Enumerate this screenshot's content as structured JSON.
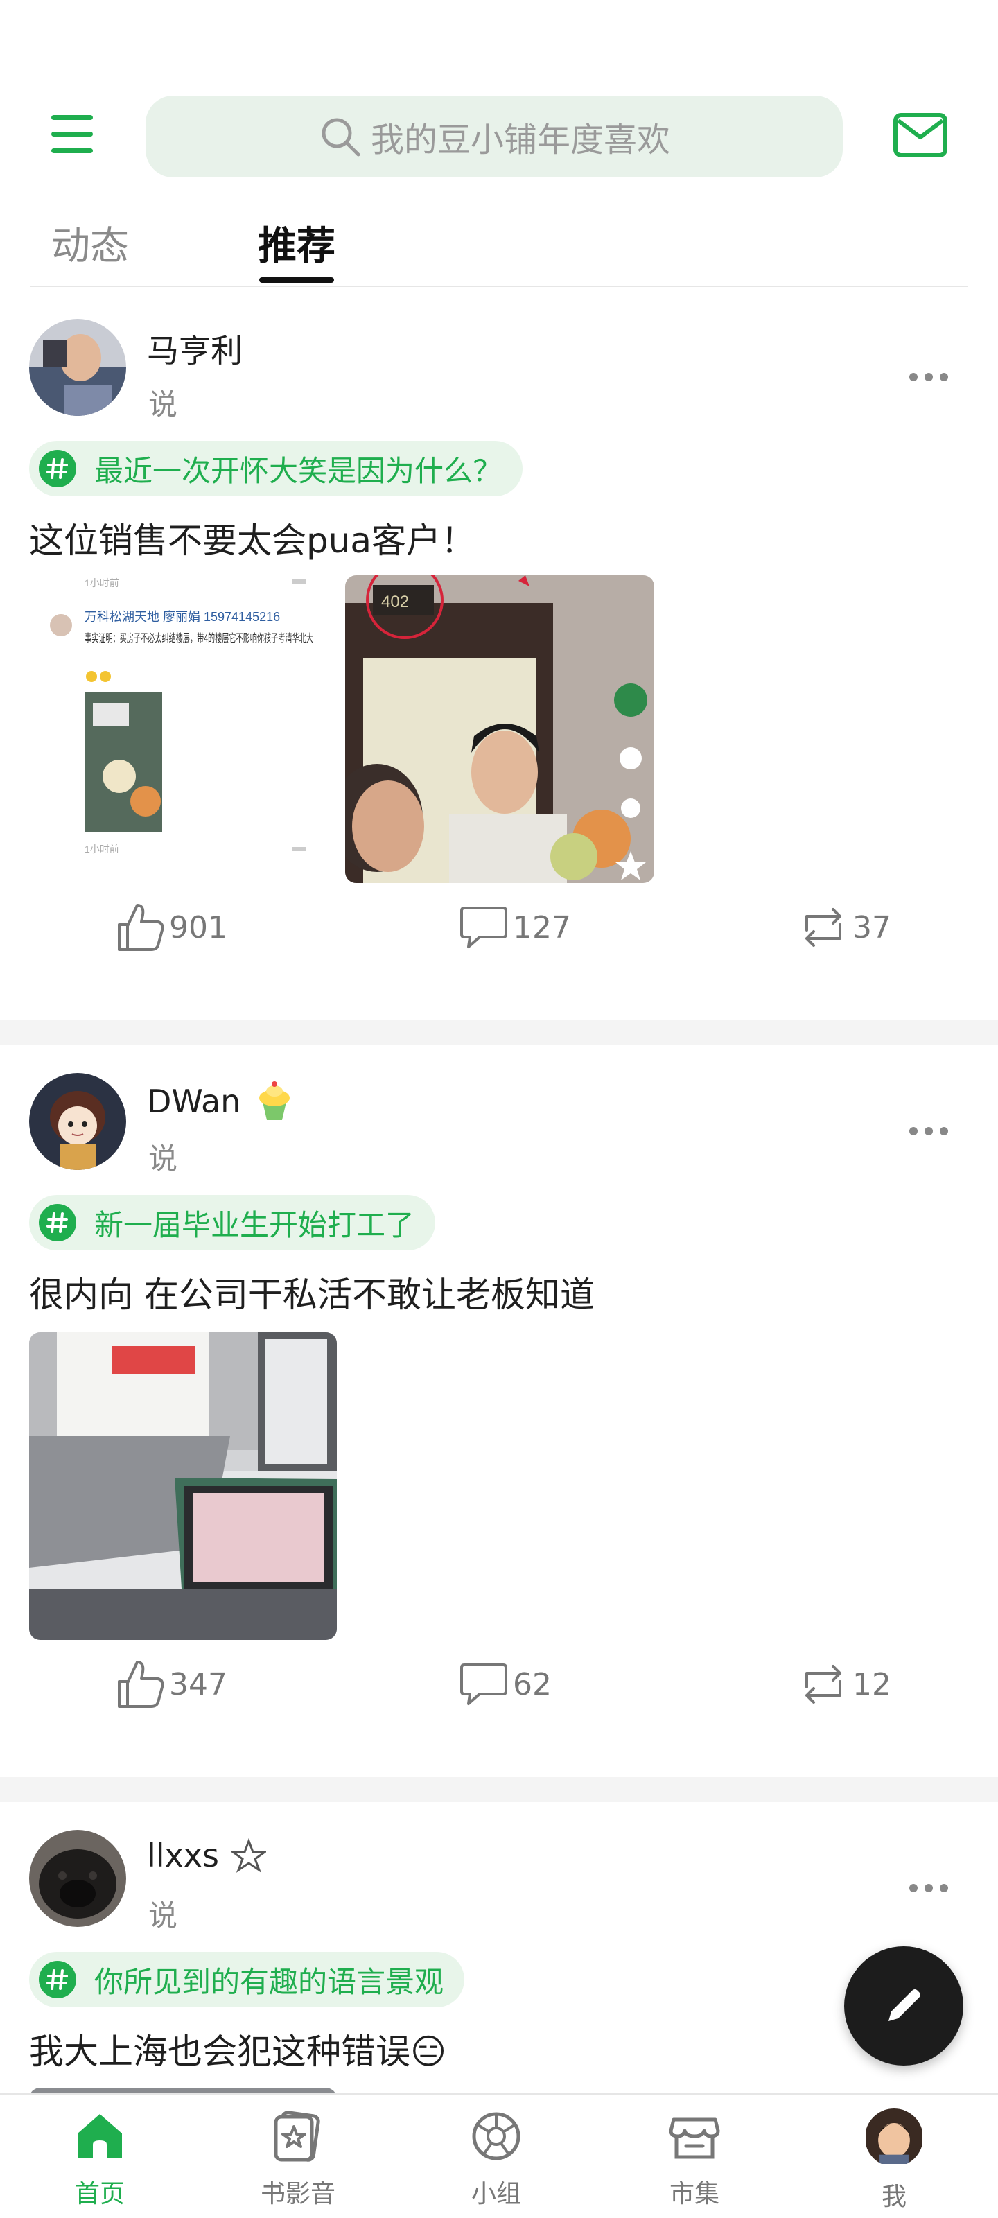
{
  "header": {
    "search_placeholder": "我的豆小铺年度喜欢",
    "tabs": [
      {
        "label": "动态",
        "active": false
      },
      {
        "label": "推荐",
        "active": true
      }
    ]
  },
  "posts": [
    {
      "author": "马亨利",
      "action": "说",
      "topic": "最近一次开怀大笑是因为什么？",
      "text": "这位销售不要太会pua客户！",
      "image_texts": [
        "1小时前",
        "万科松湖天地 廖丽娟 15974145216",
        "事实证明：买房子不必太纠结楼层，带4的楼层它不影响你孩子考清华北大",
        "1小时前",
        "402"
      ],
      "likes": "901",
      "comments": "127",
      "reshares": "37"
    },
    {
      "author": "DWan",
      "action": "说",
      "topic": "新一届毕业生开始打工了",
      "text": "很内向 在公司干私活不敢让老板知道",
      "likes": "347",
      "comments": "62",
      "reshares": "12"
    },
    {
      "author": "llxxs",
      "action": "说",
      "topic": "你所见到的有趣的语言景观",
      "text": "我大上海也会犯这种错误😑"
    }
  ],
  "bottom_nav": [
    {
      "label": "首页",
      "icon": "home-icon",
      "active": true
    },
    {
      "label": "书影音",
      "icon": "star-card-icon",
      "active": false
    },
    {
      "label": "小组",
      "icon": "group-icon",
      "active": false
    },
    {
      "label": "市集",
      "icon": "market-icon",
      "active": false
    },
    {
      "label": "我",
      "icon": "avatar",
      "active": false
    }
  ],
  "colors": {
    "accent": "#1fae4e",
    "topic_bg": "#e8f5ea",
    "search_bg": "#e8f2ea",
    "fab": "#1c1c1c"
  }
}
